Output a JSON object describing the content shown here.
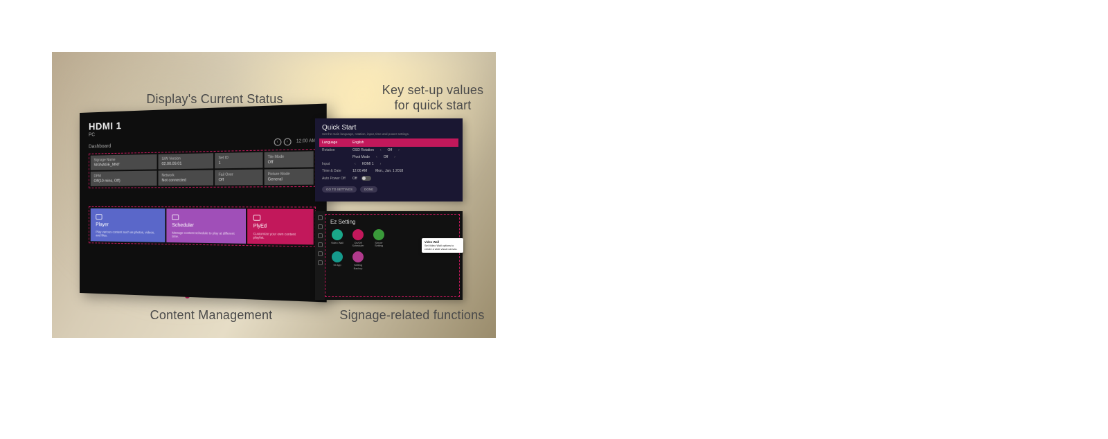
{
  "annotations": {
    "top_left": "Display's Current Status",
    "top_right_l1": "Key set-up values",
    "top_right_l2": "for quick start",
    "bot_left": "Content Management",
    "bot_right": "Signage-related functions"
  },
  "tv": {
    "input": "HDMI 1",
    "input_sub": "PC",
    "section": "Dashboard",
    "clock": "12:00 AM",
    "status_rows": [
      [
        {
          "h": "Signage Name",
          "v": "SIGNAGE_MNT"
        },
        {
          "h": "S/W Version",
          "v": "02.00.09.01"
        },
        {
          "h": "Set ID",
          "v": "1"
        },
        {
          "h": "Tile Mode",
          "v": "Off"
        }
      ],
      [
        {
          "h": "DPM",
          "v": "Off(10 mins, Off)"
        },
        {
          "h": "Network",
          "v": "Not connected"
        },
        {
          "h": "Fail Over",
          "v": "Off"
        },
        {
          "h": "Picture Mode",
          "v": "General"
        }
      ]
    ],
    "tiles": [
      {
        "title": "Player",
        "sub": "Play various content such as photos, videos, and files."
      },
      {
        "title": "Scheduler",
        "sub": "Manage content schedule to play at different time."
      },
      {
        "title": "PlyEd",
        "sub": "Customize your own content playlist."
      }
    ]
  },
  "quickstart": {
    "title": "Quick Start",
    "sub": "Set the main language, rotation, input, time and power settings.",
    "rows": [
      {
        "k": "Language",
        "v": "English",
        "hl": true
      },
      {
        "k": "Rotation",
        "v": "OSD Rotation",
        "arrows": true,
        "right": "Off"
      },
      {
        "k": "",
        "v": "Pivot Mode",
        "arrows": true,
        "right": "Off"
      },
      {
        "k": "Input",
        "v": "HDMI 1",
        "arrows": true
      },
      {
        "k": "Time & Date",
        "v": "12:00 AM",
        "extra": "Mon., Jan. 1 2018"
      },
      {
        "k": "Auto Power Off",
        "v": "Off",
        "toggle": true
      }
    ],
    "buttons": [
      "GO TO SETTINGS",
      "DONE"
    ]
  },
  "ez": {
    "title": "Ez Setting",
    "icons": [
      {
        "name": "Video Wall",
        "color": "c-teal"
      },
      {
        "name": "On/Off Scheduler",
        "color": "c-pink2"
      },
      {
        "name": "Server Setting",
        "color": "c-green"
      },
      {
        "name": "SI App",
        "color": "c-teal2"
      },
      {
        "name": "Setting Backup",
        "color": "c-mag"
      }
    ],
    "tooltip_h": "Video Wall",
    "tooltip_b": "Set Video Wall options to create a wide visual canvas."
  }
}
